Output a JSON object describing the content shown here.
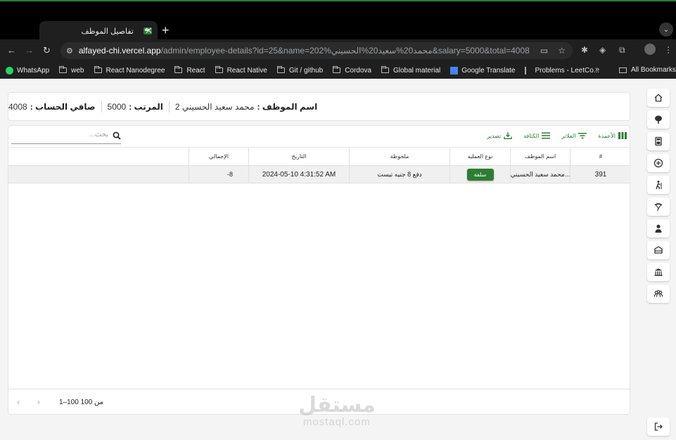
{
  "browser": {
    "tab_title": "تفاصيل الموظف",
    "url_host": "alfayed-chi.vercel.app",
    "url_path": "/admin/employee-details?id=25&name=202%محمد20%سعيد20%الحسيني&salary=5000&total=4008",
    "bookmarks": [
      "WhatsApp",
      "web",
      "React Nanodegree",
      "React",
      "React Native",
      "Git / github",
      "Cordova",
      "Global material",
      "Google Translate",
      "Problems - LeetCo..."
    ],
    "all_bookmarks": "All Bookmarks"
  },
  "summary": {
    "name_label": "اسم الموظف :",
    "name_value": "محمد سعيد الحسيني 2",
    "salary_label": "المرتب :",
    "salary_value": "5000",
    "net_label": "صافي الحساب :",
    "net_value": "4008"
  },
  "toolbar": {
    "columns": "الأعمدة",
    "filters": "الفلاتر",
    "density": "الكثافة",
    "export": "تصدير",
    "search_placeholder": "بحث..."
  },
  "table": {
    "headers": [
      "#",
      "اسم الموظف",
      "نوع العمليه",
      "ملحوظة",
      "التاريخ",
      "الإجمالي"
    ],
    "rows": [
      {
        "id": "391",
        "name": "محمد سعيد الحسيني...",
        "type": "سلفة",
        "note": "دفع 8 جنيه تيست",
        "date": "2024-05-10 4:31:52 AM",
        "total": "-8"
      }
    ]
  },
  "footer": {
    "range": "1–100 من 100"
  },
  "watermark": {
    "ar": "مستقل",
    "en": "mostaql.com"
  },
  "colors": {
    "accent": "#2e7d32"
  }
}
